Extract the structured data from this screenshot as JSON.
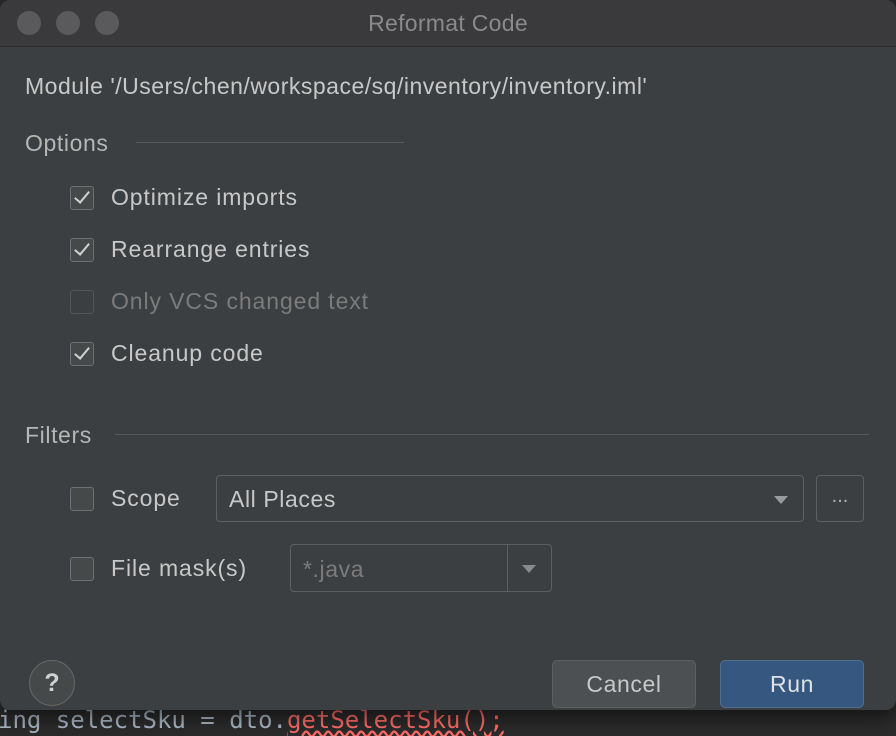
{
  "window": {
    "title": "Reformat Code"
  },
  "module_line": "Module '/Users/chen/workspace/sq/inventory/inventory.iml'",
  "options": {
    "label": "Options",
    "items": [
      {
        "label": "Optimize imports",
        "checked": true,
        "enabled": true
      },
      {
        "label": "Rearrange entries",
        "checked": true,
        "enabled": true
      },
      {
        "label": "Only VCS changed text",
        "checked": false,
        "enabled": false
      },
      {
        "label": "Cleanup code",
        "checked": true,
        "enabled": true
      }
    ]
  },
  "filters": {
    "label": "Filters",
    "scope": {
      "label": "Scope",
      "checked": false,
      "selected": "All Places",
      "browse_label": "..."
    },
    "file_mask": {
      "label": "File mask(s)",
      "checked": false,
      "value": "*.java"
    }
  },
  "buttons": {
    "help": "?",
    "cancel": "Cancel",
    "run": "Run"
  },
  "editor_peek": {
    "prefix": "ing selectSku = dto.",
    "error_part": "getSelectSku();"
  },
  "colors": {
    "dialog_bg": "#3c3f41",
    "primary_button": "#365880",
    "text": "#c8c8c8",
    "disabled_text": "#7b7b7b"
  }
}
